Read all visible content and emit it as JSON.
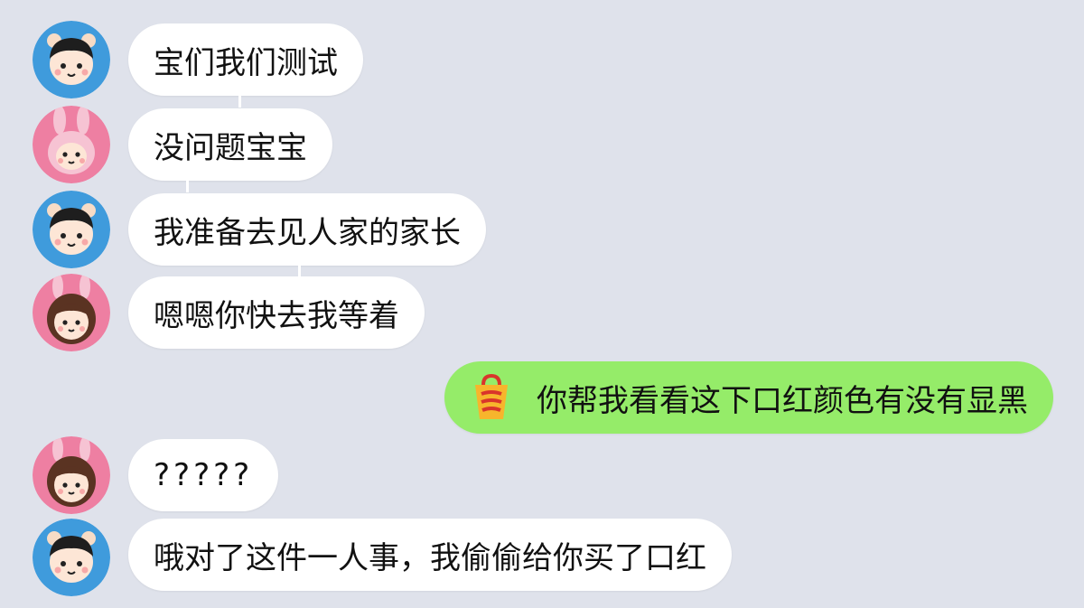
{
  "messages": [
    {
      "sender": "boy",
      "side": "left",
      "text": "宝们我们测试"
    },
    {
      "sender": "girl",
      "side": "left",
      "text": "没问题宝宝"
    },
    {
      "sender": "boy",
      "side": "left",
      "text": "我准备去见人家的家长"
    },
    {
      "sender": "girl",
      "side": "left",
      "text": "嗯嗯你快去我等着"
    },
    {
      "sender": "me",
      "side": "right",
      "text": "你帮我看看这下口红颜色有没有显黑",
      "icon": "lipstick-bag-icon"
    },
    {
      "sender": "girl",
      "side": "left",
      "text": "?????"
    },
    {
      "sender": "boy",
      "side": "left",
      "text": "哦对了这件一人事，我偷偷给你买了口红"
    }
  ],
  "colors": {
    "background": "#dfe2eb",
    "bubble_incoming": "#ffffff",
    "bubble_outgoing": "#95ec69",
    "avatar_boy": "#3f9bdc",
    "avatar_girl": "#ee7fa2"
  }
}
